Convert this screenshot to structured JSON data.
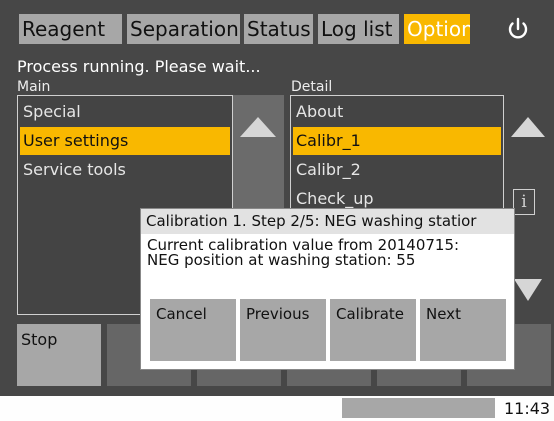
{
  "tabs": [
    {
      "label": "Reagent",
      "active": false
    },
    {
      "label": "Separation",
      "active": false
    },
    {
      "label": "Status",
      "active": false
    },
    {
      "label": "Log list",
      "active": false
    },
    {
      "label": "Option",
      "active": true
    }
  ],
  "power_icon": "power-icon",
  "status_message": "Process running. Please wait...",
  "main_list": {
    "label": "Main",
    "items": [
      "Special",
      "User settings",
      "Service tools"
    ],
    "selected_index": 1
  },
  "detail_list": {
    "label": "Detail",
    "items": [
      "About",
      "Calibr_1",
      "Calibr_2",
      "Check_up"
    ],
    "selected_index": 1
  },
  "info_button": {
    "icon": "info-icon",
    "glyph": "i"
  },
  "bottom_bar": {
    "stop_label": "Stop"
  },
  "dialog": {
    "title": "Calibration 1. Step 2/5: NEG washing statior",
    "line1": "Current calibration value from 20140715:",
    "line2": "NEG position at washing station: 55",
    "buttons": {
      "cancel": "Cancel",
      "previous": "Previous",
      "calibrate": "Calibrate",
      "next": "Next"
    }
  },
  "statusbar": {
    "time": "11:43"
  },
  "colors": {
    "accent": "#f9b800",
    "background": "#474747",
    "button": "#a7a7a7"
  }
}
